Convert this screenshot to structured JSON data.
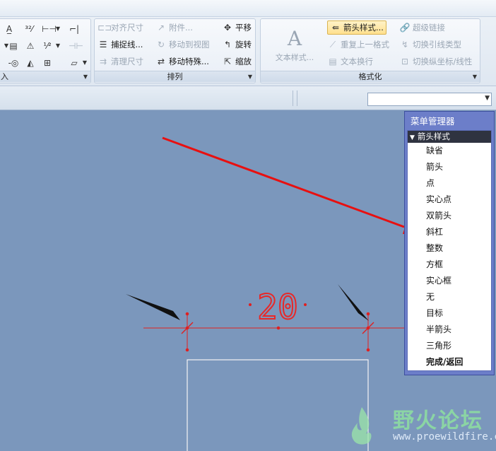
{
  "ribbon": {
    "group_left_label": "入",
    "group_arrange": {
      "label": "排列",
      "buttons": {
        "align_dim": "对齐尺寸",
        "attach": "附件...",
        "pan": "平移",
        "snap_line": "捕捉线...",
        "move_to_view": "移动到视图",
        "rotate": "旋转",
        "cleanup_dim": "清理尺寸",
        "move_special": "移动特殊...",
        "scale": "缩放"
      }
    },
    "group_format": {
      "label": "格式化",
      "buttons": {
        "text_style": "文本样式...",
        "arrow_style": "箭头样式...",
        "hyperlink": "超级链接",
        "repeat_last_format": "重复上一格式",
        "toggle_leader_type": "切换引线类型",
        "text_wrap": "文本换行",
        "toggle_ordinate_linear": "切换纵坐标/线性"
      }
    }
  },
  "menu_manager": {
    "title": "菜单管理器",
    "header": "箭头样式",
    "items": [
      "缺省",
      "箭头",
      "点",
      "实心点",
      "双箭头",
      "斜杠",
      "整数",
      "方框",
      "实心框",
      "无",
      "目标",
      "半箭头",
      "三角形"
    ],
    "done": "完成/返回"
  },
  "drawing": {
    "dimension_value": "20"
  },
  "watermark": {
    "title": "野火论坛",
    "url": "www.proewildfire.cn"
  }
}
